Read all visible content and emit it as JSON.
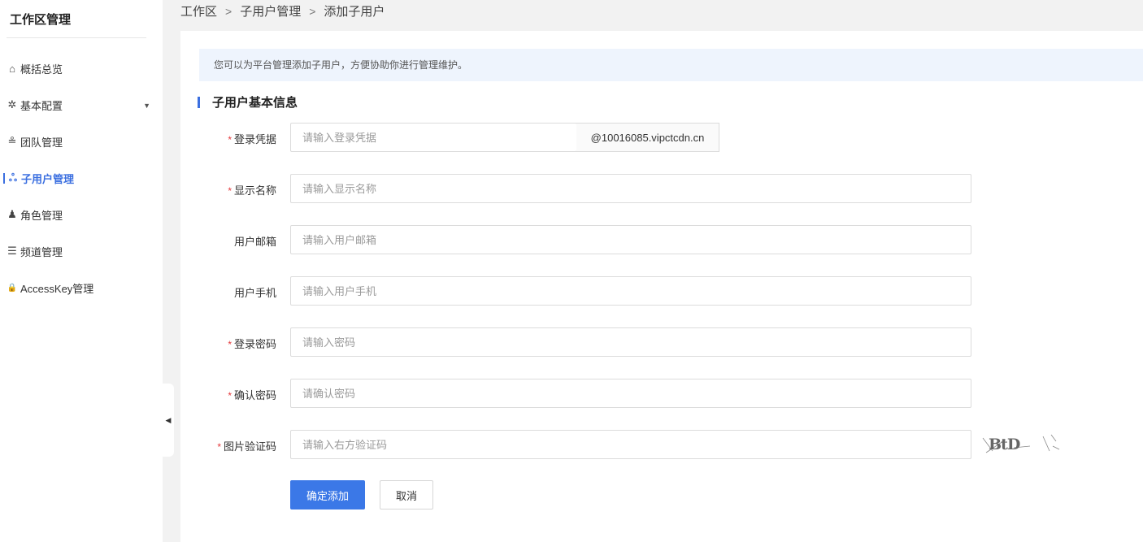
{
  "sidebar": {
    "title": "工作区管理",
    "items": [
      {
        "label": "概括总览",
        "icon": "home-icon",
        "glyph": "⌂"
      },
      {
        "label": "基本配置",
        "icon": "gear-icon",
        "glyph": "✲",
        "caret": "▼"
      },
      {
        "label": "团队管理",
        "icon": "team-icon",
        "glyph": "≗"
      },
      {
        "label": "子用户管理",
        "icon": "sitemap-icon",
        "glyph": "ஃ",
        "active": true
      },
      {
        "label": "角色管理",
        "icon": "user-icon",
        "glyph": "♟"
      },
      {
        "label": "频道管理",
        "icon": "sliders-icon",
        "glyph": "☰"
      },
      {
        "label": "AccessKey管理",
        "icon": "lock-icon",
        "glyph": "🔒"
      }
    ],
    "collapse_glyph": "◀"
  },
  "breadcrumb": {
    "items": [
      "工作区",
      "子用户管理",
      "添加子用户"
    ],
    "separator": ">"
  },
  "notice": "您可以为平台管理添加子用户，方便协助你进行管理维护。",
  "section_title": "子用户基本信息",
  "form": {
    "required_mark": "*",
    "login": {
      "label": "登录凭据",
      "placeholder": "请输入登录凭据",
      "suffix": "@10016085.vipctcdn.cn"
    },
    "display_name": {
      "label": "显示名称",
      "placeholder": "请输入显示名称"
    },
    "email": {
      "label": "用户邮箱",
      "placeholder": "请输入用户邮箱"
    },
    "phone": {
      "label": "用户手机",
      "placeholder": "请输入用户手机"
    },
    "password": {
      "label": "登录密码",
      "placeholder": "请输入密码"
    },
    "confirm_password": {
      "label": "确认密码",
      "placeholder": "请确认密码"
    },
    "captcha": {
      "label": "图片验证码",
      "placeholder": "请输入右方验证码",
      "image_text": "BtD"
    }
  },
  "buttons": {
    "submit": "确定添加",
    "cancel": "取消"
  },
  "colors": {
    "accent": "#3b78e7",
    "required": "#e4393c",
    "notice_bg": "#eef4fd"
  }
}
